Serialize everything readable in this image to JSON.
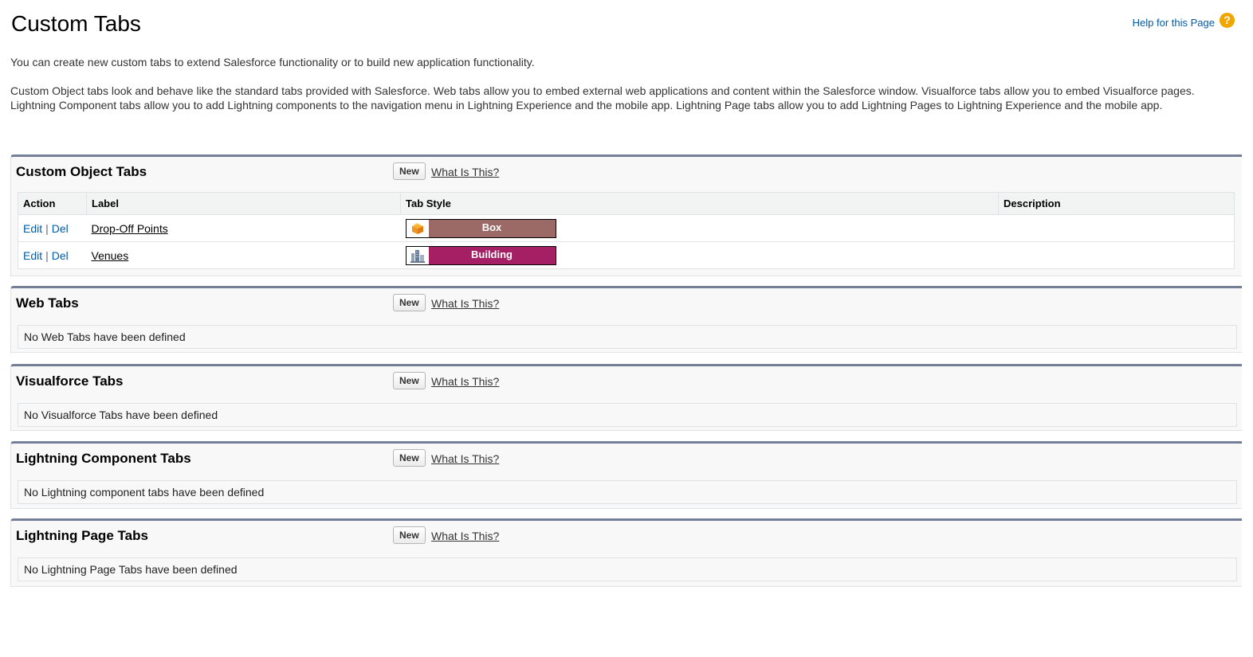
{
  "header": {
    "title": "Custom Tabs",
    "help_label": "Help for this Page",
    "help_icon": "?"
  },
  "intro": {
    "line1": "You can create new custom tabs to extend Salesforce functionality or to build new application functionality.",
    "line2": "Custom Object tabs look and behave like the standard tabs provided with Salesforce. Web tabs allow you to embed external web applications and content within the Salesforce window. Visualforce tabs allow you to embed Visualforce pages. Lightning Component tabs allow you to add Lightning components to the navigation menu in Lightning Experience and the mobile app. Lightning Page tabs allow you to add Lightning Pages to Lightning Experience and the mobile app."
  },
  "common": {
    "new_label": "New",
    "what_label": "What Is This?"
  },
  "custom_object_tabs": {
    "title": "Custom Object Tabs",
    "columns": [
      "Action",
      "Label",
      "Tab Style",
      "Description"
    ],
    "rows": [
      {
        "edit": "Edit",
        "sep": "|",
        "del": "Del",
        "label": "Drop-Off Points",
        "style_name": "Box",
        "style_color": "#9c6a66",
        "style_icon": "box-icon",
        "description": ""
      },
      {
        "edit": "Edit",
        "sep": "|",
        "del": "Del",
        "label": "Venues",
        "style_name": "Building",
        "style_color": "#a51f64",
        "style_icon": "building-icon",
        "description": ""
      }
    ]
  },
  "web_tabs": {
    "title": "Web Tabs",
    "empty": "No Web Tabs have been defined"
  },
  "visualforce_tabs": {
    "title": "Visualforce Tabs",
    "empty": "No Visualforce Tabs have been defined"
  },
  "lightning_component_tabs": {
    "title": "Lightning Component Tabs",
    "empty": "No Lightning component tabs have been defined"
  },
  "lightning_page_tabs": {
    "title": "Lightning Page Tabs",
    "empty": "No Lightning Page Tabs have been defined"
  },
  "colors": {
    "link": "#015ba7",
    "section_border": "#747e96",
    "help_icon": "#f0a500"
  }
}
